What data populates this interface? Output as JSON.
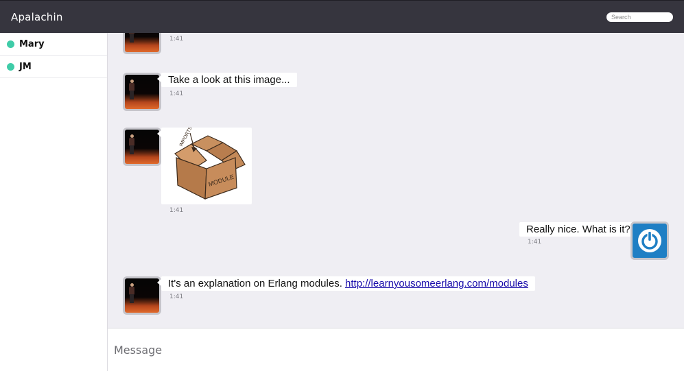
{
  "app": {
    "title": "Apalachin"
  },
  "search": {
    "placeholder": "Search"
  },
  "colors": {
    "online": "#3fcca8",
    "topbar": "#36353e",
    "link": "#1a0dab",
    "self_avatar": "#1f7fc4"
  },
  "contacts": [
    {
      "name": "Mary",
      "status": "online"
    },
    {
      "name": "JM",
      "status": "online"
    }
  ],
  "messages": [
    {
      "sender": "contact",
      "type": "text",
      "text": "",
      "time": "1:41"
    },
    {
      "sender": "contact",
      "type": "text",
      "text": "Take a look at this image...",
      "time": "1:41"
    },
    {
      "sender": "contact",
      "type": "image",
      "image_label": "MODULE",
      "image_caption": "IMPORTS",
      "time": "1:41"
    },
    {
      "sender": "self",
      "type": "text",
      "text": "Really nice. What is it?",
      "time": "1:41"
    },
    {
      "sender": "contact",
      "type": "text_link",
      "text": "It's an explanation on Erlang modules.",
      "link": "http://learnyousomeerlang.com/modules",
      "time": "1:41"
    }
  ],
  "icons": {
    "self_avatar": "power-icon",
    "contact_avatar": "person-on-stage-photo"
  },
  "composer": {
    "placeholder": "Message"
  }
}
